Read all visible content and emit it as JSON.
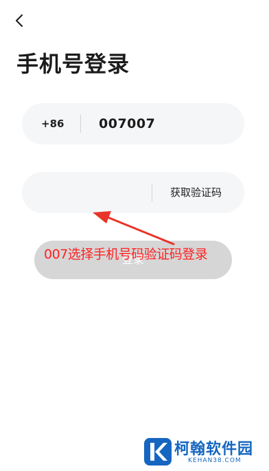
{
  "header": {
    "back_icon": "chevron-left-icon",
    "title": "手机号登录"
  },
  "phone": {
    "country_code": "+86",
    "number": "007007"
  },
  "verification": {
    "code_value": "",
    "get_code_label": "获取验证码"
  },
  "login_button": {
    "label": "登录"
  },
  "overlay": {
    "caption": "007选择手机号码验证码登录",
    "caption_color": "#ff2222",
    "arrow_color": "#e8342a"
  },
  "watermark": {
    "name": "柯翰软件园",
    "domain": "KEHAN38.COM",
    "brand_color": "#1566c0"
  }
}
